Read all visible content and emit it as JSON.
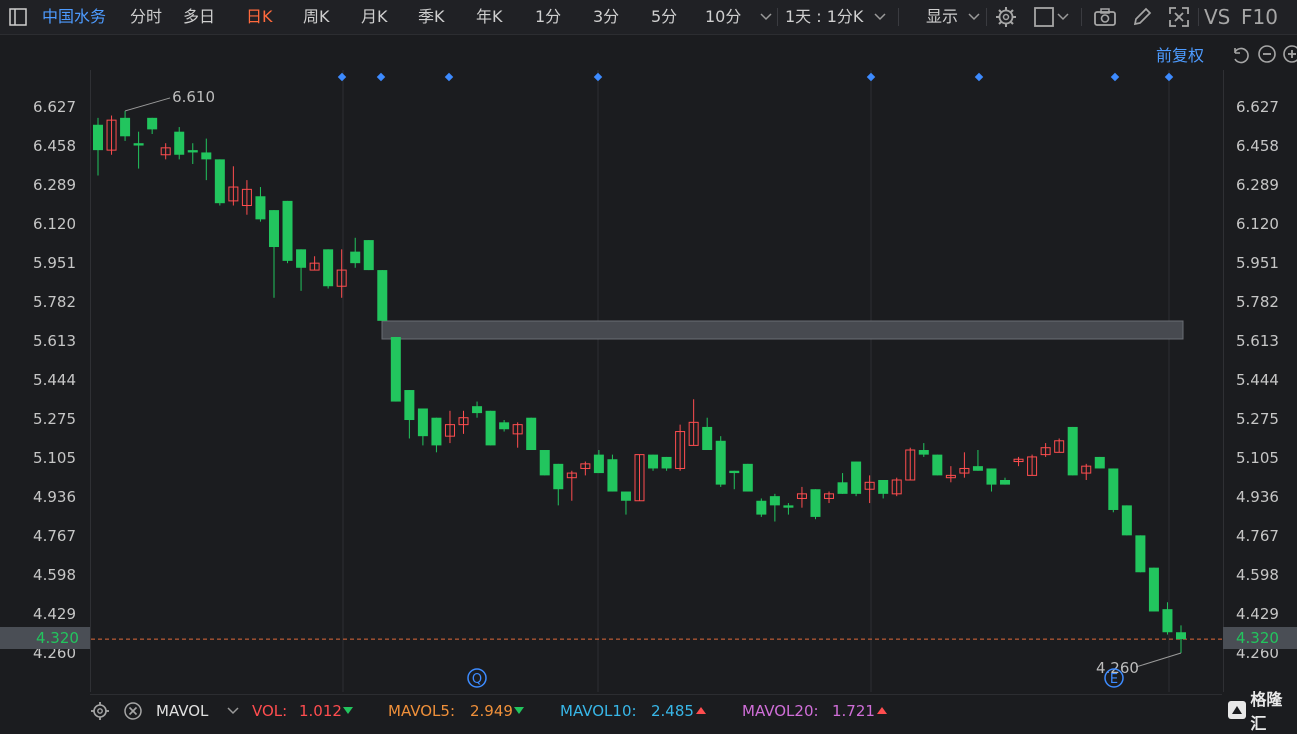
{
  "toolbar": {
    "stock_name": "中国水务",
    "periods": [
      "分时",
      "多日",
      "日K",
      "周K",
      "月K",
      "季K",
      "年K",
      "1分",
      "3分",
      "5分",
      "10分"
    ],
    "active_period": "日K",
    "range_select": "1天 : 1分K",
    "display": "显示",
    "vs_label": "VS",
    "f10_label": "F10"
  },
  "adjust_label": "前复权",
  "colors": {
    "up": "#ff4d4f",
    "down": "#22c55e",
    "background": "#1b1c1f",
    "accent": "#4d9bff",
    "dashed_line": "#e0693a"
  },
  "icons": [
    "settings-icon",
    "rectangle-icon",
    "camera-icon",
    "pencil-icon",
    "fullscreen-icon",
    "undo-icon",
    "zoom-out-icon",
    "zoom-in-icon",
    "gear-icon",
    "close-icon",
    "chevron-down-icon",
    "q-marker-icon",
    "e-marker-icon"
  ],
  "annotations": {
    "high_label": "6.610",
    "low_label": "4.260",
    "q_marker": "Q",
    "e_marker": "E"
  },
  "current_price": "4.320",
  "indicators": {
    "name": "MAVOL",
    "vol_label": "VOL:",
    "vol_value": "1.012",
    "mavol5_label": "MAVOL5:",
    "mavol5_value": "2.949",
    "mavol10_label": "MAVOL10:",
    "mavol10_value": "2.485",
    "mavol20_label": "MAVOL20:",
    "mavol20_value": "1.721"
  },
  "logo_text": "格隆汇",
  "chart_data": {
    "type": "candlestick",
    "y_ticks": [
      "6.627",
      "6.458",
      "6.289",
      "6.120",
      "5.951",
      "5.782",
      "5.613",
      "5.444",
      "5.275",
      "5.105",
      "4.936",
      "4.767",
      "4.598",
      "4.429",
      "4.260"
    ],
    "ylim": [
      4.26,
      6.627
    ],
    "candles": [
      {
        "o": 6.55,
        "h": 6.58,
        "l": 6.33,
        "c": 6.44
      },
      {
        "o": 6.44,
        "h": 6.59,
        "l": 6.42,
        "c": 6.57
      },
      {
        "o": 6.58,
        "h": 6.61,
        "l": 6.48,
        "c": 6.5
      },
      {
        "o": 6.47,
        "h": 6.52,
        "l": 6.36,
        "c": 6.46
      },
      {
        "o": 6.58,
        "h": 6.58,
        "l": 6.51,
        "c": 6.53
      },
      {
        "o": 6.42,
        "h": 6.47,
        "l": 6.4,
        "c": 6.45
      },
      {
        "o": 6.52,
        "h": 6.54,
        "l": 6.4,
        "c": 6.42
      },
      {
        "o": 6.44,
        "h": 6.47,
        "l": 6.38,
        "c": 6.43
      },
      {
        "o": 6.43,
        "h": 6.49,
        "l": 6.31,
        "c": 6.4
      },
      {
        "o": 6.4,
        "h": 6.4,
        "l": 6.2,
        "c": 6.21
      },
      {
        "o": 6.22,
        "h": 6.37,
        "l": 6.2,
        "c": 6.28
      },
      {
        "o": 6.2,
        "h": 6.31,
        "l": 6.16,
        "c": 6.27
      },
      {
        "o": 6.24,
        "h": 6.28,
        "l": 6.13,
        "c": 6.14
      },
      {
        "o": 6.18,
        "h": 6.18,
        "l": 5.8,
        "c": 6.02
      },
      {
        "o": 6.22,
        "h": 6.22,
        "l": 5.95,
        "c": 5.96
      },
      {
        "o": 6.01,
        "h": 6.01,
        "l": 5.83,
        "c": 5.93
      },
      {
        "o": 5.92,
        "h": 5.98,
        "l": 5.92,
        "c": 5.95
      },
      {
        "o": 6.01,
        "h": 6.01,
        "l": 5.84,
        "c": 5.85
      },
      {
        "o": 5.85,
        "h": 6.01,
        "l": 5.8,
        "c": 5.92
      },
      {
        "o": 6.0,
        "h": 6.06,
        "l": 5.93,
        "c": 5.95
      },
      {
        "o": 6.05,
        "h": 6.05,
        "l": 5.92,
        "c": 5.92
      },
      {
        "o": 5.92,
        "h": 5.92,
        "l": 5.7,
        "c": 5.7
      },
      {
        "o": 5.63,
        "h": 5.63,
        "l": 5.35,
        "c": 5.35
      },
      {
        "o": 5.4,
        "h": 5.4,
        "l": 5.19,
        "c": 5.27
      },
      {
        "o": 5.32,
        "h": 5.32,
        "l": 5.16,
        "c": 5.2
      },
      {
        "o": 5.28,
        "h": 5.28,
        "l": 5.13,
        "c": 5.16
      },
      {
        "o": 5.2,
        "h": 5.31,
        "l": 5.17,
        "c": 5.25
      },
      {
        "o": 5.25,
        "h": 5.31,
        "l": 5.21,
        "c": 5.28
      },
      {
        "o": 5.33,
        "h": 5.35,
        "l": 5.28,
        "c": 5.3
      },
      {
        "o": 5.31,
        "h": 5.31,
        "l": 5.16,
        "c": 5.16
      },
      {
        "o": 5.26,
        "h": 5.27,
        "l": 5.22,
        "c": 5.23
      },
      {
        "o": 5.21,
        "h": 5.26,
        "l": 5.15,
        "c": 5.25
      },
      {
        "o": 5.28,
        "h": 5.28,
        "l": 5.14,
        "c": 5.14
      },
      {
        "o": 5.14,
        "h": 5.14,
        "l": 5.03,
        "c": 5.03
      },
      {
        "o": 5.08,
        "h": 5.08,
        "l": 4.9,
        "c": 4.97
      },
      {
        "o": 5.02,
        "h": 5.05,
        "l": 4.92,
        "c": 5.04
      },
      {
        "o": 5.06,
        "h": 5.09,
        "l": 5.03,
        "c": 5.08
      },
      {
        "o": 5.12,
        "h": 5.14,
        "l": 5.04,
        "c": 5.04
      },
      {
        "o": 5.1,
        "h": 5.12,
        "l": 4.96,
        "c": 4.96
      },
      {
        "o": 4.96,
        "h": 4.96,
        "l": 4.86,
        "c": 4.92
      },
      {
        "o": 4.92,
        "h": 5.12,
        "l": 4.92,
        "c": 5.12
      },
      {
        "o": 5.12,
        "h": 5.12,
        "l": 5.05,
        "c": 5.06
      },
      {
        "o": 5.11,
        "h": 5.11,
        "l": 5.05,
        "c": 5.06
      },
      {
        "o": 5.06,
        "h": 5.25,
        "l": 5.05,
        "c": 5.22
      },
      {
        "o": 5.16,
        "h": 5.36,
        "l": 5.16,
        "c": 5.26
      },
      {
        "o": 5.24,
        "h": 5.28,
        "l": 5.14,
        "c": 5.14
      },
      {
        "o": 5.18,
        "h": 5.2,
        "l": 4.98,
        "c": 4.99
      },
      {
        "o": 5.05,
        "h": 5.05,
        "l": 4.97,
        "c": 5.04
      },
      {
        "o": 5.08,
        "h": 5.08,
        "l": 4.96,
        "c": 4.96
      },
      {
        "o": 4.92,
        "h": 4.93,
        "l": 4.85,
        "c": 4.86
      },
      {
        "o": 4.94,
        "h": 4.95,
        "l": 4.83,
        "c": 4.9
      },
      {
        "o": 4.9,
        "h": 4.91,
        "l": 4.86,
        "c": 4.89
      },
      {
        "o": 4.93,
        "h": 4.98,
        "l": 4.89,
        "c": 4.95
      },
      {
        "o": 4.97,
        "h": 4.97,
        "l": 4.84,
        "c": 4.85
      },
      {
        "o": 4.93,
        "h": 4.96,
        "l": 4.91,
        "c": 4.95
      },
      {
        "o": 5.0,
        "h": 5.04,
        "l": 4.95,
        "c": 4.95
      },
      {
        "o": 5.09,
        "h": 5.09,
        "l": 4.94,
        "c": 4.95
      },
      {
        "o": 4.97,
        "h": 5.03,
        "l": 4.91,
        "c": 5.0
      },
      {
        "o": 5.01,
        "h": 5.01,
        "l": 4.93,
        "c": 4.95
      },
      {
        "o": 4.95,
        "h": 5.02,
        "l": 4.94,
        "c": 5.01
      },
      {
        "o": 5.01,
        "h": 5.15,
        "l": 5.01,
        "c": 5.14
      },
      {
        "o": 5.14,
        "h": 5.17,
        "l": 5.11,
        "c": 5.12
      },
      {
        "o": 5.12,
        "h": 5.12,
        "l": 5.03,
        "c": 5.03
      },
      {
        "o": 5.02,
        "h": 5.07,
        "l": 5.0,
        "c": 5.03
      },
      {
        "o": 5.04,
        "h": 5.13,
        "l": 5.02,
        "c": 5.06
      },
      {
        "o": 5.07,
        "h": 5.14,
        "l": 5.05,
        "c": 5.05
      },
      {
        "o": 5.06,
        "h": 5.06,
        "l": 4.96,
        "c": 4.99
      },
      {
        "o": 5.01,
        "h": 5.02,
        "l": 4.99,
        "c": 4.99
      },
      {
        "o": 5.09,
        "h": 5.11,
        "l": 5.07,
        "c": 5.1
      },
      {
        "o": 5.03,
        "h": 5.12,
        "l": 5.03,
        "c": 5.11
      },
      {
        "o": 5.12,
        "h": 5.17,
        "l": 5.11,
        "c": 5.15
      },
      {
        "o": 5.13,
        "h": 5.19,
        "l": 5.13,
        "c": 5.18
      },
      {
        "o": 5.24,
        "h": 5.24,
        "l": 5.03,
        "c": 5.03
      },
      {
        "o": 5.04,
        "h": 5.08,
        "l": 5.01,
        "c": 5.07
      },
      {
        "o": 5.11,
        "h": 5.11,
        "l": 5.06,
        "c": 5.06
      },
      {
        "o": 5.06,
        "h": 5.06,
        "l": 4.87,
        "c": 4.88
      },
      {
        "o": 4.9,
        "h": 4.9,
        "l": 4.77,
        "c": 4.77
      },
      {
        "o": 4.77,
        "h": 4.77,
        "l": 4.61,
        "c": 4.61
      },
      {
        "o": 4.63,
        "h": 4.63,
        "l": 4.44,
        "c": 4.44
      },
      {
        "o": 4.45,
        "h": 4.48,
        "l": 4.34,
        "c": 4.35
      },
      {
        "o": 4.35,
        "h": 4.38,
        "l": 4.26,
        "c": 4.32
      }
    ]
  }
}
